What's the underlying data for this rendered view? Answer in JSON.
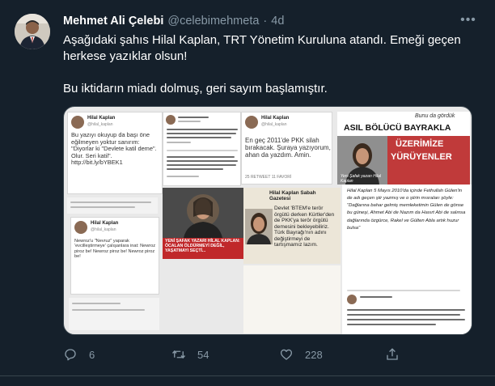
{
  "author": {
    "display_name": "Mehmet Ali Çelebi",
    "handle": "@celebimehmeta",
    "separator": "·",
    "time": "4d"
  },
  "more_label": "•••",
  "tweet_text": {
    "line1": "Aşağıdaki şahıs Hilal Kaplan, TRT Yönetim Kuruluna atandı. Emeği geçen herkese yazıklar olsun!",
    "line2": "Bu iktidarın miadı dolmuş, geri sayım başlamıştır."
  },
  "collage": {
    "p1_name": "Hilal Kaplan",
    "p1_handle": "@hilal_kaplan",
    "p1_text": "Bu yazıyı okuyup da başı öne eğilmeyen yoktur sanırım: \"Diyorlar ki \"Devlete katil deme\". Olur. Seri katil\". http://bit.ly/bYBEK1",
    "p3_name": "Hilal Kaplan",
    "p3_handle": "@hilal_kaplan",
    "p3_text": "En geç 2011'de PKK silah bırakacak. Şuraya yazıyorum, ahan da yazdım. Amin.",
    "p3_stats": "25 RETWEET   11 FAVORİ",
    "p4_top": "Bunu da gördük",
    "p4_headline_1": "ASIL BÖLÜCÜ BAYRAKLA",
    "p4_headline_2": "ÜZERİMİZE",
    "p4_headline_3": "YÜRÜYENLER",
    "p4_caption": "Yeni Şafak yazarı Hilal Kaplan",
    "p5_name": "Hilal Kaplan",
    "p5_handle": "@hilal_kaplan",
    "p5_text": "Newroz'u \"Nevruz\" yaparak 'evcilleştirmeye' çalışanlara inat: Newroz piroz be! Newroz piroz be! Newroz piroz be!",
    "p6_caption": "YENİ ŞAFAK YAZARI HİLAL KAPLAN: ÖCALAN ÖLDÜRMEYİ DEĞİL, YAŞATMAYI SEÇTİ...",
    "p7_header": "Hilal Kaplan Sabah Gazetesi",
    "p7_text": "Devlet 'BTEM'e terör örgütü derken Kürtler'den de PKK'ya terör örgütü demesini bekleyebiliriz. Türk Bayrağı'nın adını değiştirmeyi de tartışmamız lazım.",
    "p8_text": "Hilal Kaplan 5 Mayıs 2010'da içinde Fethullah Gülen'in de adı geçen şiir yazmış ve o şiirin mısraları şöyle: \"Dağlarına bahar gelmiş memleketimin Gülen de gönse bu güneşi, Ahmet Abi de Nazım da Hasırt Abi de salınsa dağlarında özgürce, Rakel ve Gülten Abla artık huzur bulsa\""
  },
  "actions": {
    "reply_count": "6",
    "retweet_count": "54",
    "like_count": "228"
  }
}
